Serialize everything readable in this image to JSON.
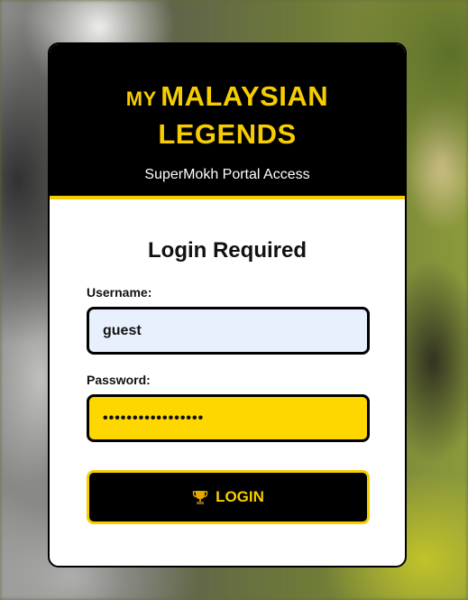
{
  "header": {
    "brand_prefix": "MY",
    "brand_line1": "MALAYSIAN",
    "brand_line2": "LEGENDS",
    "subtitle": "SuperMokh Portal Access"
  },
  "form": {
    "title": "Login Required",
    "username_label": "Username:",
    "username_value": "guest",
    "password_label": "Password:",
    "password_value": "•••••••••••••••••",
    "login_label": "LOGIN",
    "login_icon": "trophy-icon"
  },
  "colors": {
    "accent": "#f7cd00",
    "header_bg": "#000000",
    "username_bg": "#e8f0fe",
    "password_bg": "#ffd700"
  }
}
